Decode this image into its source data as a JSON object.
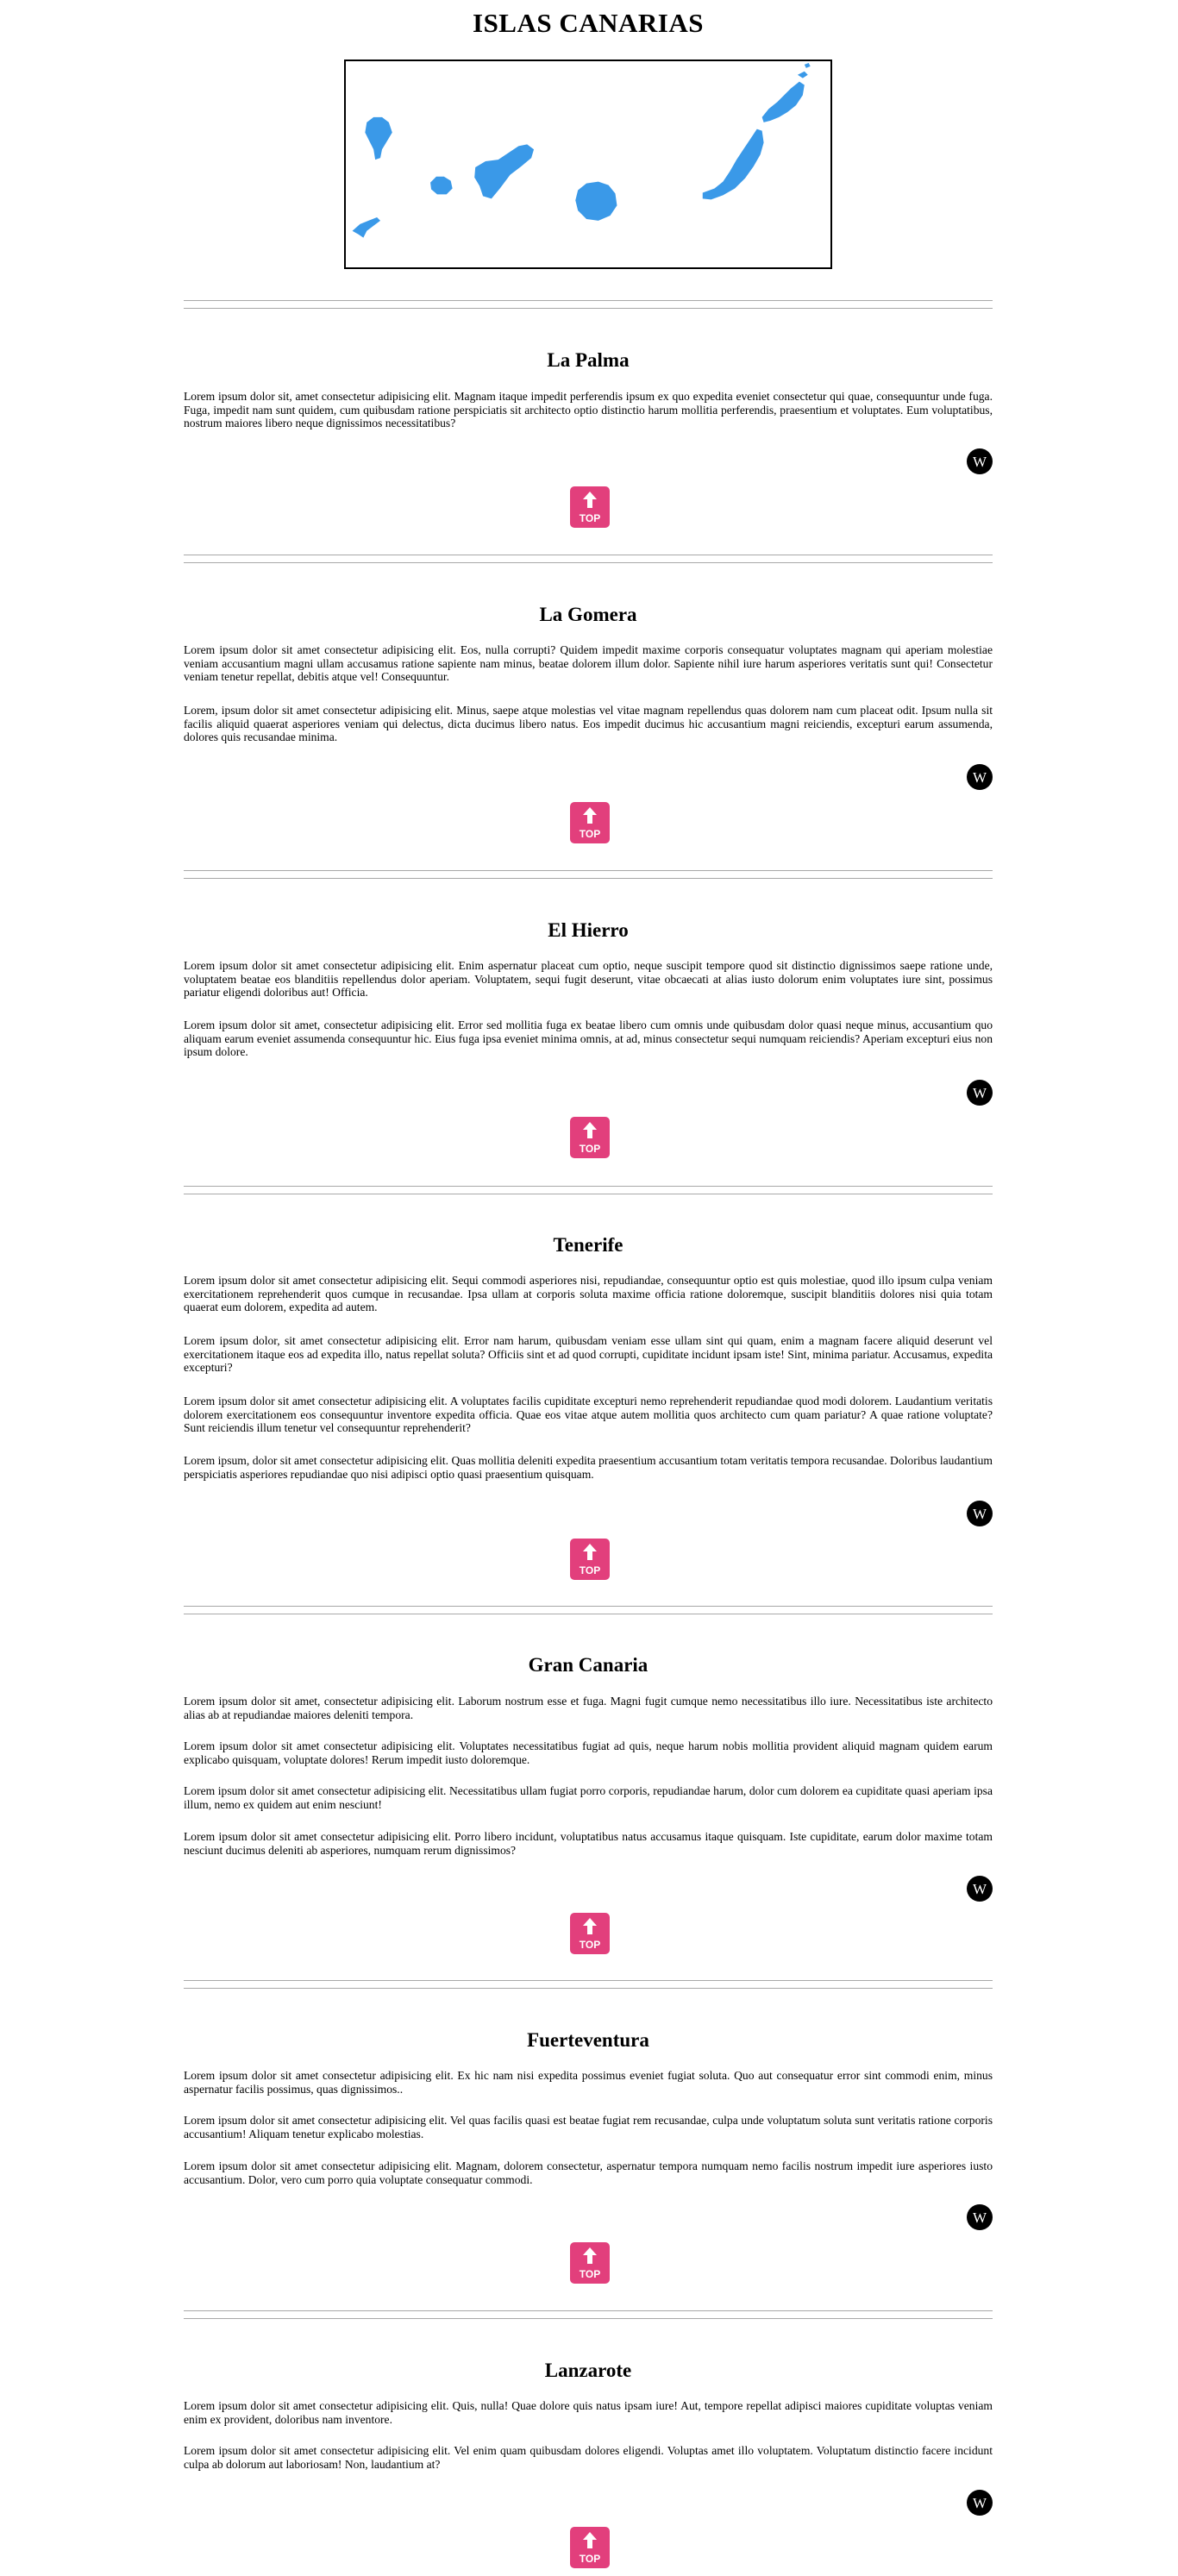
{
  "page": {
    "title": "ISLAS CANARIAS",
    "colors": {
      "map_islands": "#3a99e8",
      "top_button": "#e23f7c",
      "rule": "#a8a8a8"
    }
  },
  "map": {
    "icon": "canary-islands-map"
  },
  "top_button": {
    "label": "TOP",
    "icon": "arrow-up-icon"
  },
  "wiki": {
    "icon_glyph": "W",
    "icon": "wikipedia-icon"
  },
  "islands": [
    {
      "name": "La Palma",
      "paragraphs": [
        "Lorem ipsum dolor sit, amet consectetur adipisicing elit. Magnam itaque impedit perferendis ipsum ex quo expedita eveniet consectetur qui quae, consequuntur unde fuga. Fuga, impedit nam sunt quidem, cum quibusdam ratione perspiciatis sit architecto optio distinctio harum mollitia perferendis, praesentium et voluptates. Eum voluptatibus, nostrum maiores libero neque dignissimos necessitatibus?"
      ]
    },
    {
      "name": "La Gomera",
      "paragraphs": [
        "Lorem ipsum dolor sit amet consectetur adipisicing elit. Eos, nulla corrupti? Quidem impedit maxime corporis consequatur voluptates magnam qui aperiam molestiae veniam accusantium magni ullam accusamus ratione sapiente nam minus, beatae dolorem illum dolor. Sapiente nihil iure harum asperiores veritatis sunt qui! Consectetur veniam tenetur repellat, debitis atque vel! Consequuntur.",
        "Lorem, ipsum dolor sit amet consectetur adipisicing elit. Minus, saepe atque molestias vel vitae magnam repellendus quas dolorem nam cum placeat odit. Ipsum nulla sit facilis aliquid quaerat asperiores veniam qui delectus, dicta ducimus libero natus. Eos impedit ducimus hic accusantium magni reiciendis, excepturi earum assumenda, dolores quis recusandae minima."
      ]
    },
    {
      "name": "El Hierro",
      "paragraphs": [
        "Lorem ipsum dolor sit amet consectetur adipisicing elit. Enim aspernatur placeat cum optio, neque suscipit tempore quod sit distinctio dignissimos saepe ratione unde, voluptatem beatae eos blanditiis repellendus dolor aperiam. Voluptatem, sequi fugit deserunt, vitae obcaecati at alias iusto dolorum enim voluptates iure sint, possimus pariatur eligendi doloribus aut! Officia.",
        "Lorem ipsum dolor sit amet, consectetur adipisicing elit. Error sed mollitia fuga ex beatae libero cum omnis unde quibusdam dolor quasi neque minus, accusantium quo aliquam earum eveniet assumenda consequuntur hic. Eius fuga ipsa eveniet minima omnis, at ad, minus consectetur sequi numquam reiciendis? Aperiam excepturi eius non ipsum dolore."
      ]
    },
    {
      "name": "Tenerife",
      "paragraphs": [
        "Lorem ipsum dolor sit amet consectetur adipisicing elit. Sequi commodi asperiores nisi, repudiandae, consequuntur optio est quis molestiae, quod illo ipsum culpa veniam exercitationem reprehenderit quos cumque in recusandae. Ipsa ullam at corporis soluta maxime officia ratione doloremque, suscipit blanditiis dolores nisi quia totam quaerat eum dolorem, expedita ad autem.",
        "Lorem ipsum dolor, sit amet consectetur adipisicing elit. Error nam harum, quibusdam veniam esse ullam sint qui quam, enim a magnam facere aliquid deserunt vel exercitationem itaque eos ad expedita illo, natus repellat soluta? Officiis sint et ad quod corrupti, cupiditate incidunt ipsam iste! Sint, minima pariatur. Accusamus, expedita excepturi?",
        "Lorem ipsum dolor sit amet consectetur adipisicing elit. A voluptates facilis cupiditate excepturi nemo reprehenderit repudiandae quod modi dolorem. Laudantium veritatis dolorem exercitationem eos consequuntur inventore expedita officia. Quae eos vitae atque autem mollitia quos architecto cum quam pariatur? A quae ratione voluptate? Sunt reiciendis illum tenetur vel consequuntur reprehenderit?",
        "Lorem ipsum, dolor sit amet consectetur adipisicing elit. Quas mollitia deleniti expedita praesentium accusantium totam veritatis tempora recusandae. Doloribus laudantium perspiciatis asperiores repudiandae quo nisi adipisci optio quasi praesentium quisquam."
      ]
    },
    {
      "name": "Gran Canaria",
      "paragraphs": [
        "Lorem ipsum dolor sit amet, consectetur adipisicing elit. Laborum nostrum esse et fuga. Magni fugit cumque nemo necessitatibus illo iure. Necessitatibus iste architecto alias ab at repudiandae maiores deleniti tempora.",
        "Lorem ipsum dolor sit amet consectetur adipisicing elit. Voluptates necessitatibus fugiat ad quis, neque harum nobis mollitia provident aliquid magnam quidem earum explicabo quisquam, voluptate dolores! Rerum impedit iusto doloremque.",
        "Lorem ipsum dolor sit amet consectetur adipisicing elit. Necessitatibus ullam fugiat porro corporis, repudiandae harum, dolor cum dolorem ea cupiditate quasi aperiam ipsa illum, nemo ex quidem aut enim nesciunt!",
        "Lorem ipsum dolor sit amet consectetur adipisicing elit. Porro libero incidunt, voluptatibus natus accusamus itaque quisquam. Iste cupiditate, earum dolor maxime totam nesciunt ducimus deleniti ab asperiores, numquam rerum dignissimos?"
      ]
    },
    {
      "name": "Fuerteventura",
      "paragraphs": [
        "Lorem ipsum dolor sit amet consectetur adipisicing elit. Ex hic nam nisi expedita possimus eveniet fugiat soluta. Quo aut consequatur error sint commodi enim, minus aspernatur facilis possimus, quas dignissimos..",
        "Lorem ipsum dolor sit amet consectetur adipisicing elit. Vel quas facilis quasi est beatae fugiat rem recusandae, culpa unde voluptatum soluta sunt veritatis ratione corporis accusantium! Aliquam tenetur explicabo molestias.",
        "Lorem ipsum dolor sit amet consectetur adipisicing elit. Magnam, dolorem consectetur, aspernatur tempora numquam nemo facilis nostrum impedit iure asperiores iusto accusantium. Dolor, vero cum porro quia voluptate consequatur commodi."
      ]
    },
    {
      "name": "Lanzarote",
      "paragraphs": [
        "Lorem ipsum dolor sit amet consectetur adipisicing elit. Quis, nulla! Quae dolore quis natus ipsam iure! Aut, tempore repellat adipisci maiores cupiditate voluptas veniam enim ex provident, doloribus nam inventore.",
        "Lorem ipsum dolor sit amet consectetur adipisicing elit. Vel enim quam quibusdam dolores eligendi. Voluptas amet illo voluptatem. Voluptatum distinctio facere incidunt culpa ab dolorum aut laboriosam! Non, laudantium at?"
      ]
    }
  ]
}
